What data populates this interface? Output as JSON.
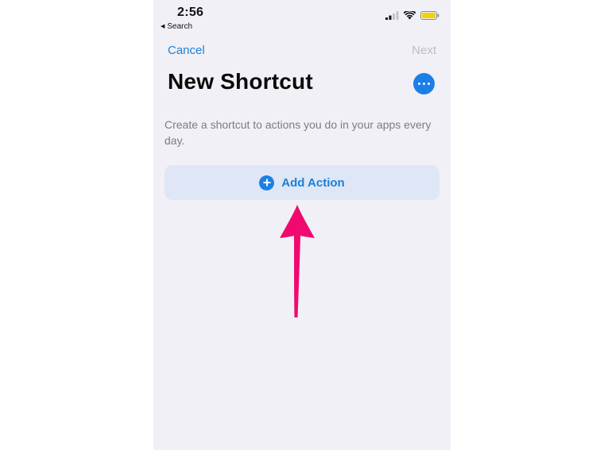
{
  "status_bar": {
    "time": "2:56",
    "back_label": "Search"
  },
  "nav": {
    "cancel_label": "Cancel",
    "next_label": "Next"
  },
  "title": "New Shortcut",
  "description": "Create a shortcut to actions you do in your apps every day.",
  "add_action_label": "Add Action",
  "colors": {
    "accent": "#1b7fe8",
    "disabled_text": "#bdbdc2",
    "annotation_arrow": "#f0096f",
    "battery": "#f5d10c"
  }
}
